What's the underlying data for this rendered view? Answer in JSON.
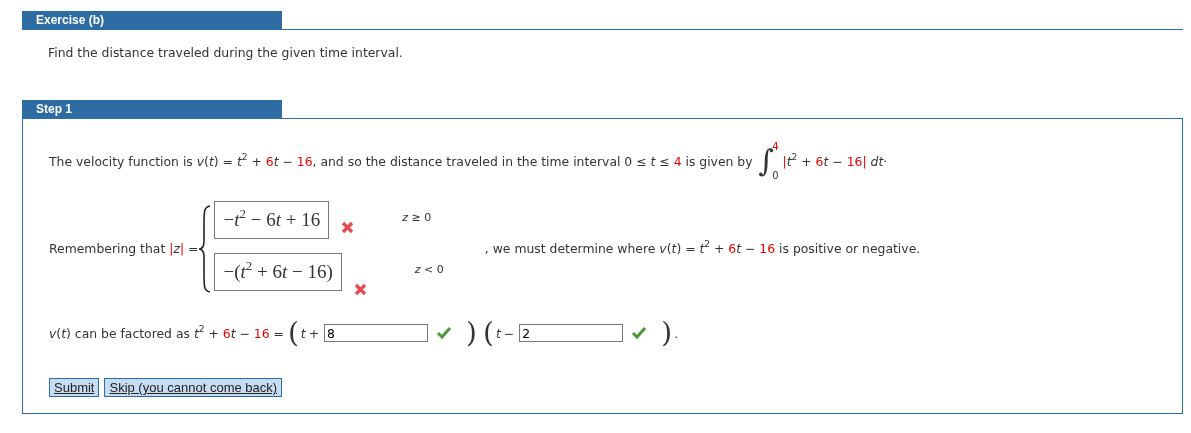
{
  "exercise": {
    "title": "Exercise (b)",
    "prompt": "Find the distance traveled during the given time interval."
  },
  "step": {
    "title": "Step 1",
    "intro": [
      {
        "kind": "text",
        "text": "The velocity function is "
      },
      {
        "kind": "var",
        "text": "v"
      },
      {
        "kind": "text",
        "text": "("
      },
      {
        "kind": "var",
        "text": "t"
      },
      {
        "kind": "text",
        "text": ") = "
      },
      {
        "kind": "var",
        "text": "t"
      },
      {
        "kind": "sup",
        "text": "2"
      },
      {
        "kind": "text",
        "text": " + "
      },
      {
        "kind": "num",
        "text": "6"
      },
      {
        "kind": "var",
        "text": "t"
      },
      {
        "kind": "text",
        "text": " − "
      },
      {
        "kind": "num",
        "text": "16"
      },
      {
        "kind": "text",
        "text": ", and so the distance traveled in the time interval 0 ≤ "
      },
      {
        "kind": "var",
        "text": "t"
      },
      {
        "kind": "text",
        "text": " ≤ "
      },
      {
        "kind": "num",
        "text": "4"
      },
      {
        "kind": "text",
        "text": " is given by"
      }
    ],
    "integral": {
      "sign": "∫",
      "upper": "4",
      "lower": "0",
      "integrand": [
        {
          "kind": "num",
          "text": "|"
        },
        {
          "kind": "var",
          "text": "t"
        },
        {
          "kind": "sup",
          "text": "2"
        },
        {
          "kind": "text",
          "text": " + "
        },
        {
          "kind": "num",
          "text": "6"
        },
        {
          "kind": "var",
          "text": "t"
        },
        {
          "kind": "text",
          "text": " − "
        },
        {
          "kind": "num",
          "text": "16"
        },
        {
          "kind": "num",
          "text": "|"
        },
        {
          "kind": "var",
          "text": " dt"
        },
        {
          "kind": "text",
          "text": "·"
        }
      ]
    },
    "piecewise": {
      "lead": [
        {
          "kind": "text",
          "text": "Remembering that "
        },
        {
          "kind": "num",
          "text": "|"
        },
        {
          "kind": "var",
          "text": "z"
        },
        {
          "kind": "num",
          "text": "|"
        },
        {
          "kind": "text",
          "text": " ="
        }
      ],
      "cases": [
        {
          "answer": [
            {
              "kind": "text",
              "text": "−"
            },
            {
              "kind": "var",
              "text": "t"
            },
            {
              "kind": "sup",
              "text": "2"
            },
            {
              "kind": "text",
              "text": " − 6"
            },
            {
              "kind": "var",
              "text": "t"
            },
            {
              "kind": "text",
              "text": " + 16"
            }
          ],
          "correct": false,
          "condition": [
            {
              "kind": "var",
              "text": "z"
            },
            {
              "kind": "text",
              "text": " ≥ 0"
            }
          ]
        },
        {
          "answer": [
            {
              "kind": "text",
              "text": "−("
            },
            {
              "kind": "var",
              "text": "t"
            },
            {
              "kind": "sup",
              "text": "2"
            },
            {
              "kind": "text",
              "text": " + 6"
            },
            {
              "kind": "var",
              "text": "t"
            },
            {
              "kind": "text",
              "text": " − 16)"
            }
          ],
          "correct": false,
          "condition": [
            {
              "kind": "var",
              "text": "z"
            },
            {
              "kind": "text",
              "text": " < 0"
            }
          ]
        }
      ],
      "tail": [
        {
          "kind": "text",
          "text": ", we must determine where "
        },
        {
          "kind": "var",
          "text": "v"
        },
        {
          "kind": "text",
          "text": "("
        },
        {
          "kind": "var",
          "text": "t"
        },
        {
          "kind": "text",
          "text": ") = "
        },
        {
          "kind": "var",
          "text": "t"
        },
        {
          "kind": "sup",
          "text": "2"
        },
        {
          "kind": "text",
          "text": " + "
        },
        {
          "kind": "num",
          "text": "6"
        },
        {
          "kind": "var",
          "text": "t"
        },
        {
          "kind": "text",
          "text": " − "
        },
        {
          "kind": "num",
          "text": "16"
        },
        {
          "kind": "text",
          "text": " is positive or negative."
        }
      ]
    },
    "factor": {
      "lead": [
        {
          "kind": "var",
          "text": "v"
        },
        {
          "kind": "text",
          "text": "("
        },
        {
          "kind": "var",
          "text": "t"
        },
        {
          "kind": "text",
          "text": ") can be factored as "
        },
        {
          "kind": "var",
          "text": "t"
        },
        {
          "kind": "sup",
          "text": "2"
        },
        {
          "kind": "text",
          "text": " + "
        },
        {
          "kind": "num",
          "text": "6"
        },
        {
          "kind": "var",
          "text": "t"
        },
        {
          "kind": "text",
          "text": " − "
        },
        {
          "kind": "num",
          "text": "16"
        },
        {
          "kind": "text",
          "text": " ="
        }
      ],
      "factors": [
        {
          "open": "(",
          "variable": "t",
          "sign": "+",
          "value": "8",
          "correct": true,
          "close": ")"
        },
        {
          "open": "(",
          "variable": "t",
          "sign": "−",
          "value": "2",
          "correct": true,
          "close": ")"
        }
      ],
      "end": "."
    },
    "buttons": [
      "Submit",
      "Skip (you cannot come back)"
    ]
  }
}
